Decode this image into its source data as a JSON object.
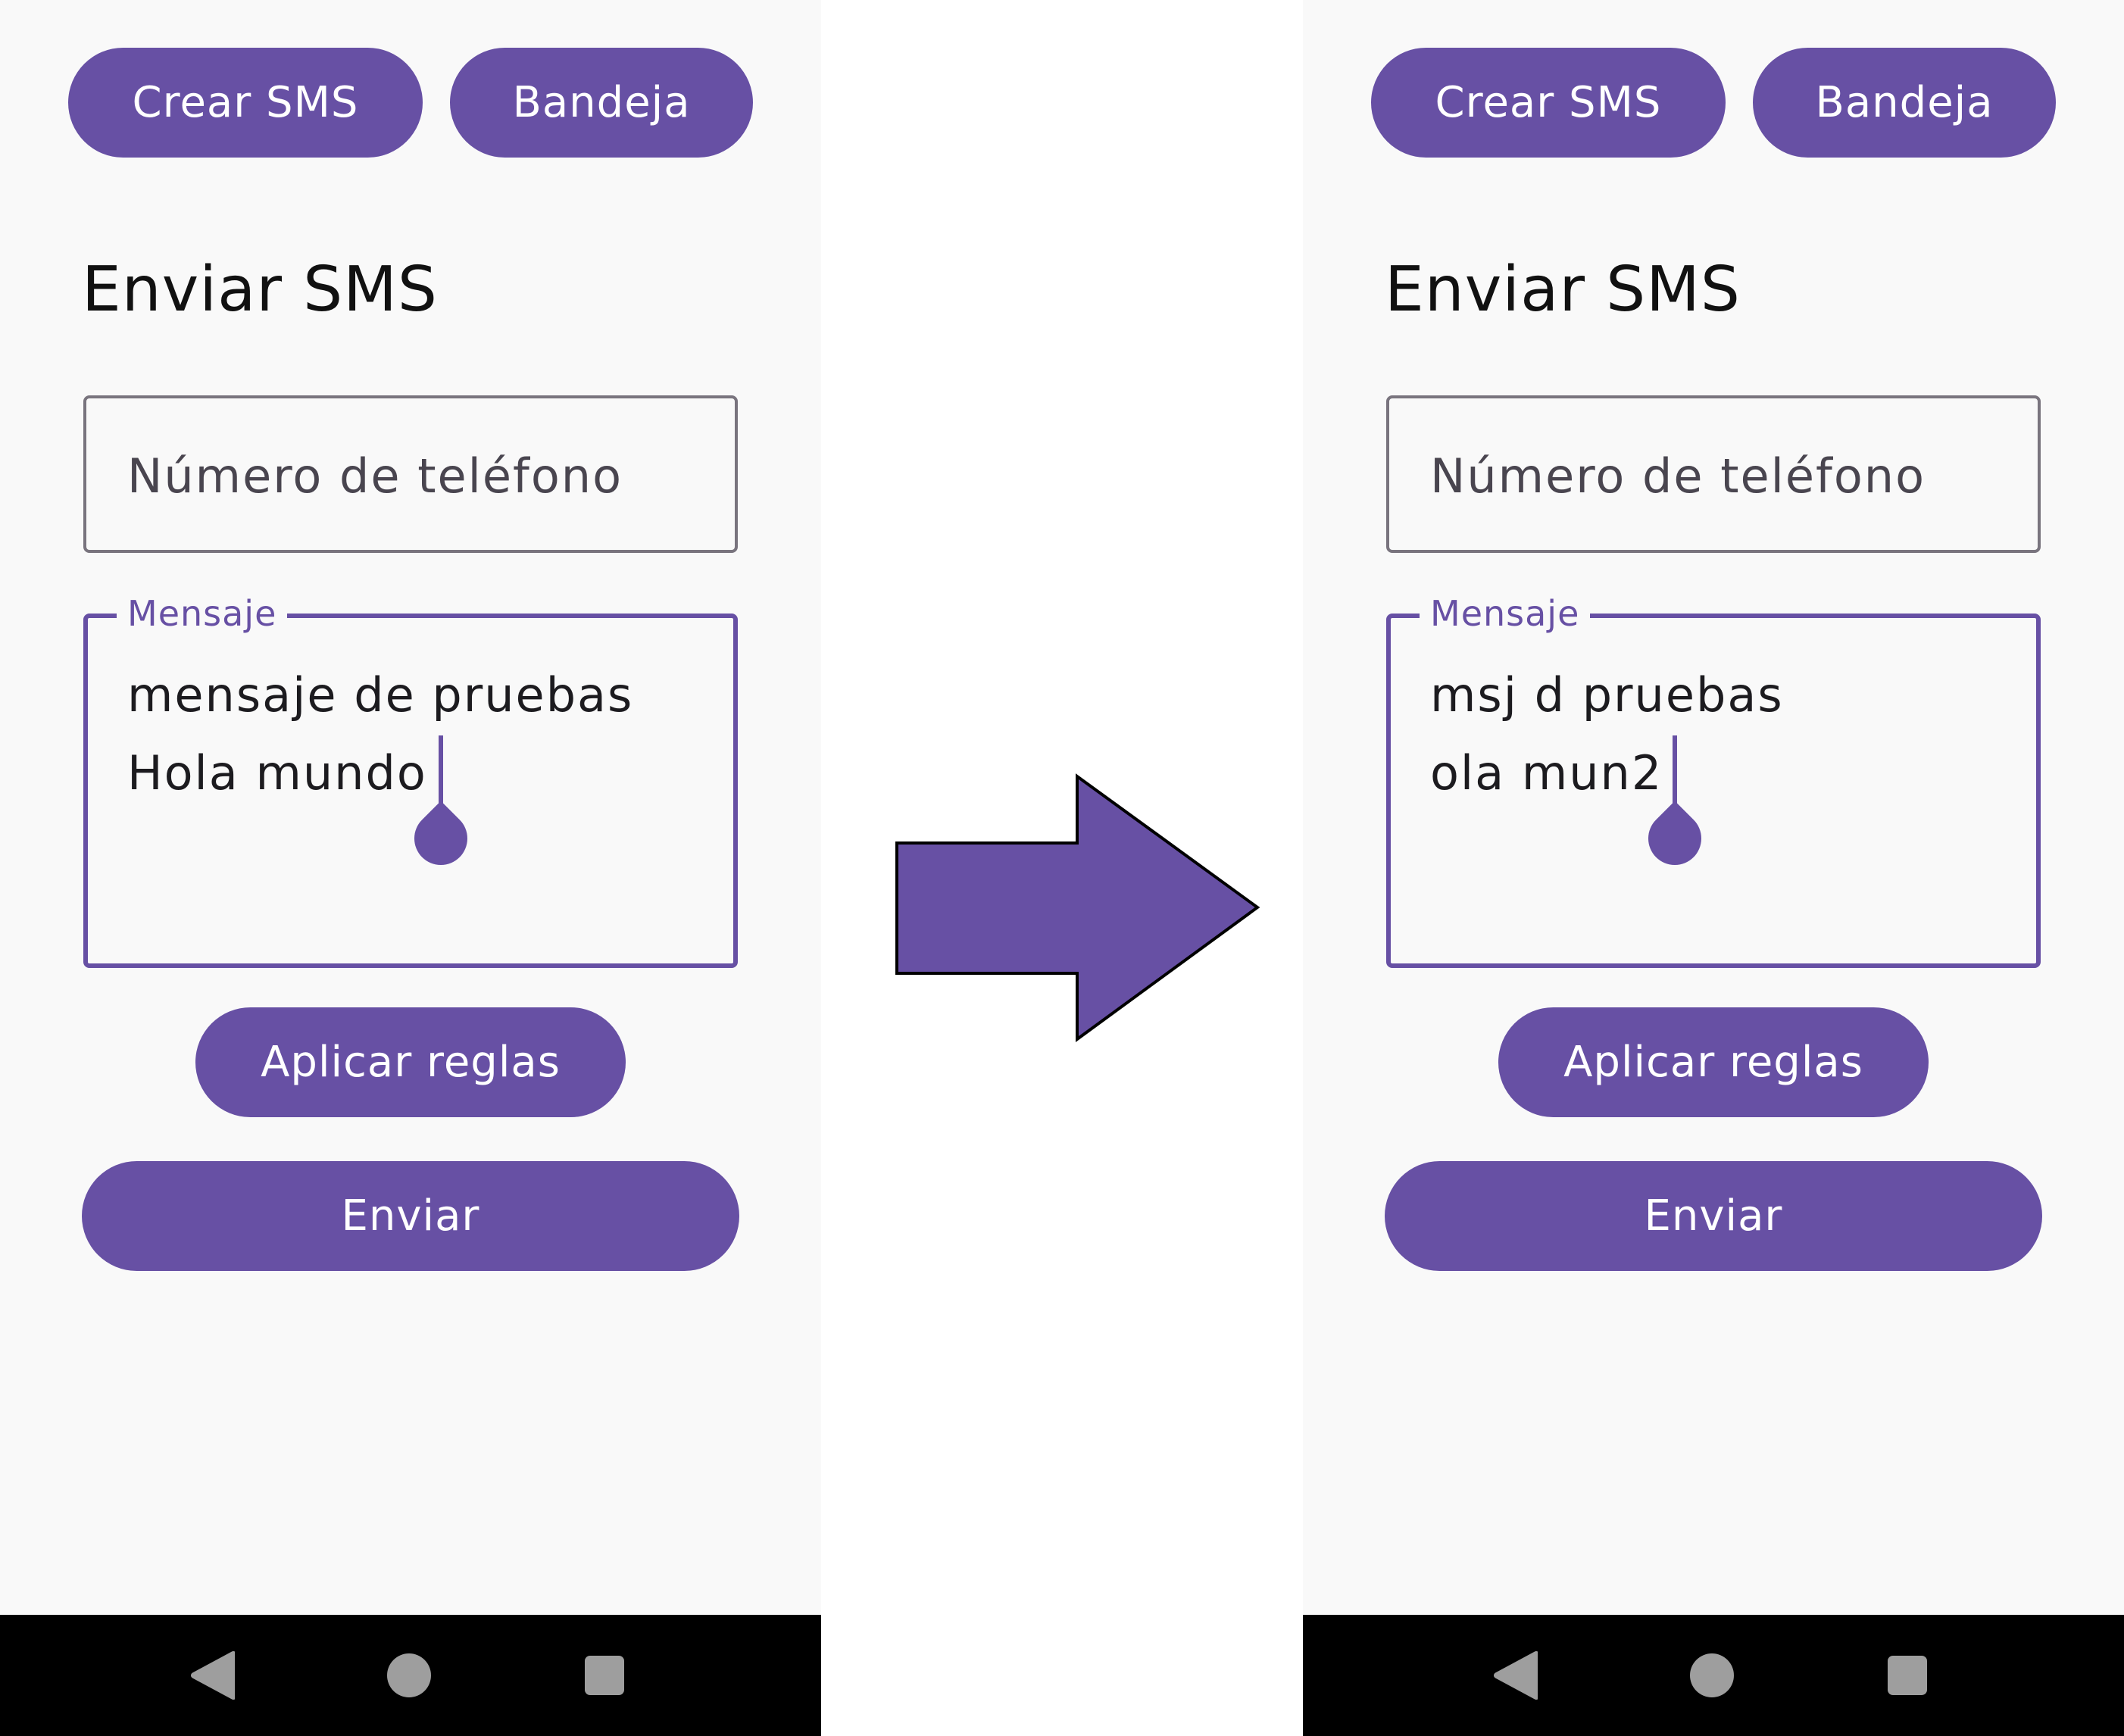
{
  "colors": {
    "primary": "#6750a4",
    "screen_background": "#f9f9f9",
    "navbar": "#000000",
    "nav_icons": "#9e9e9e"
  },
  "before": {
    "top_buttons": {
      "crear": "Crear SMS",
      "bandeja": "Bandeja"
    },
    "title": "Enviar SMS",
    "phone_field": {
      "placeholder": "Número de teléfono"
    },
    "message_field": {
      "label": "Mensaje",
      "lines": [
        "mensaje de pruebas",
        "Hola mundo"
      ]
    },
    "apply_button": "Aplicar reglas",
    "send_button": "Enviar",
    "nav_icons": [
      "back-icon",
      "home-icon",
      "recents-icon"
    ]
  },
  "after": {
    "top_buttons": {
      "crear": "Crear SMS",
      "bandeja": "Bandeja"
    },
    "title": "Enviar SMS",
    "phone_field": {
      "placeholder": "Número de teléfono"
    },
    "message_field": {
      "label": "Mensaje",
      "lines": [
        "msj d pruebas",
        "ola mun2"
      ]
    },
    "apply_button": "Aplicar reglas",
    "send_button": "Enviar",
    "nav_icons": [
      "back-icon",
      "home-icon",
      "recents-icon"
    ]
  },
  "transition_icon": "right-arrow-icon"
}
